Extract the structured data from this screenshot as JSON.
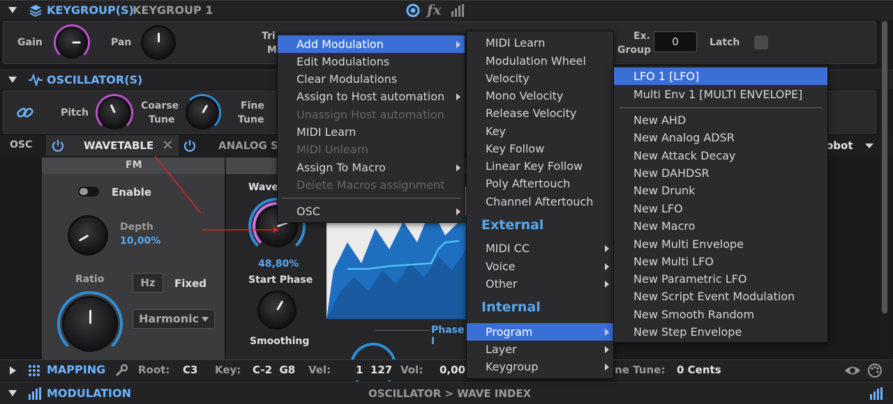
{
  "keygroup_header": {
    "title": "KEYGROUP(S)",
    "name": "KEYGROUP 1",
    "fx_label": "fx"
  },
  "keygroup_row": {
    "gain_label": "Gain",
    "pan_label": "Pan",
    "trig_label_partial": "Tri",
    "trig_label_partial2": "M",
    "ex_group_label_1": "Ex.",
    "ex_group_label_2": "Group",
    "ex_group_value": "0",
    "latch_label": "Latch"
  },
  "oscillator_header": {
    "title": "OSCILLATOR(S)"
  },
  "oscillator_row": {
    "pitch_label": "Pitch",
    "coarse_label_1": "Coarse",
    "coarse_label_2": "Tune",
    "fine_label_1": "Fine",
    "fine_label_2": "Tune"
  },
  "osc_tabs": {
    "osc_label": "OSC",
    "wavetable_label": "WAVETABLE",
    "analog_label": "ANALOG ST",
    "right_partial": "obot"
  },
  "fm_panel": {
    "title": "FM",
    "enable_label": "Enable",
    "depth_label": "Depth",
    "depth_value": "10,00%",
    "ratio_label": "Ratio",
    "hz_label": "Hz",
    "fixed_label": "Fixed",
    "harmonic_label": "Harmonic"
  },
  "wave_panel": {
    "wave_label_partial": "Wave",
    "wave_value": "48,80%",
    "start_phase_label": "Start Phase",
    "smoothing_label": "Smoothing",
    "phase_partial": "Phase I"
  },
  "mapping_bar": {
    "title": "MAPPING",
    "root_label": "Root:",
    "root_value": "C3",
    "key_label": "Key:",
    "key_value": "C-2  G8",
    "vel_label": "Vel:",
    "vel_value": "1  127",
    "vol_label": "Vol:",
    "vol_value": "0,00",
    "fine_tune_partial": "ine Tune:",
    "fine_tune_value": "0 Cents"
  },
  "modulation_bar": {
    "title": "MODULATION",
    "path": "OSCILLATOR > WAVE INDEX"
  },
  "menu1": {
    "items": [
      {
        "label": "Add Modulation",
        "state": "selected",
        "sub": true
      },
      {
        "label": "Edit Modulations",
        "state": "normal",
        "sub": false
      },
      {
        "label": "Clear Modulations",
        "state": "normal",
        "sub": false
      },
      {
        "label": "Assign to Host automation",
        "state": "normal",
        "sub": true
      },
      {
        "label": "Unassign Host automation",
        "state": "disabled",
        "sub": false
      },
      {
        "label": "MIDI Learn",
        "state": "normal",
        "sub": false
      },
      {
        "label": "MIDI Unlearn",
        "state": "disabled",
        "sub": false
      },
      {
        "label": "Assign To Macro",
        "state": "normal",
        "sub": true
      },
      {
        "label": "Delete Macros assignment",
        "state": "disabled",
        "sub": false
      },
      {
        "label": "OSC",
        "state": "normal",
        "sub": true
      }
    ]
  },
  "menu2": {
    "items": [
      {
        "label": "MIDI Learn",
        "type": "item",
        "sub": false
      },
      {
        "label": "Modulation Wheel",
        "type": "item",
        "sub": false
      },
      {
        "label": "Velocity",
        "type": "item",
        "sub": false
      },
      {
        "label": "Mono Velocity",
        "type": "item",
        "sub": false
      },
      {
        "label": "Release Velocity",
        "type": "item",
        "sub": false
      },
      {
        "label": "Key",
        "type": "item",
        "sub": false
      },
      {
        "label": "Key Follow",
        "type": "item",
        "sub": false
      },
      {
        "label": "Linear Key Follow",
        "type": "item",
        "sub": false
      },
      {
        "label": "Poly Aftertouch",
        "type": "item",
        "sub": false
      },
      {
        "label": "Channel Aftertouch",
        "type": "item",
        "sub": false
      },
      {
        "label": "External",
        "type": "head",
        "sub": false
      },
      {
        "label": "MIDI CC",
        "type": "item",
        "sub": true
      },
      {
        "label": "Voice",
        "type": "item",
        "sub": true
      },
      {
        "label": "Other",
        "type": "item",
        "sub": true
      },
      {
        "label": "Internal",
        "type": "head",
        "sub": false
      },
      {
        "label": "Program",
        "type": "selected",
        "sub": true
      },
      {
        "label": "Layer",
        "type": "item",
        "sub": true
      },
      {
        "label": "Keygroup",
        "type": "item",
        "sub": true
      }
    ]
  },
  "menu3": {
    "items": [
      {
        "label": "LFO 1 [LFO]",
        "state": "selected"
      },
      {
        "label": "Multi Env 1 [MULTI ENVELOPE]",
        "state": "normal"
      },
      {
        "label": "New AHD",
        "state": "normal"
      },
      {
        "label": "New Analog ADSR",
        "state": "normal"
      },
      {
        "label": "New Attack Decay",
        "state": "normal"
      },
      {
        "label": "New DAHDSR",
        "state": "normal"
      },
      {
        "label": "New Drunk",
        "state": "normal"
      },
      {
        "label": "New LFO",
        "state": "normal"
      },
      {
        "label": "New Macro",
        "state": "normal"
      },
      {
        "label": "New Multi Envelope",
        "state": "normal"
      },
      {
        "label": "New Multi LFO",
        "state": "normal"
      },
      {
        "label": "New Parametric LFO",
        "state": "normal"
      },
      {
        "label": "New Script Event Modulation",
        "state": "normal"
      },
      {
        "label": "New Smooth Random",
        "state": "normal"
      },
      {
        "label": "New Step Envelope",
        "state": "normal"
      }
    ]
  },
  "colors": {
    "accent_blue": "#6cb4ff",
    "menu_select": "#3a6fd8",
    "knob_ring": "#2d8fd8",
    "mod_ring": "#c050d0",
    "arrow_red": "#e02020"
  }
}
